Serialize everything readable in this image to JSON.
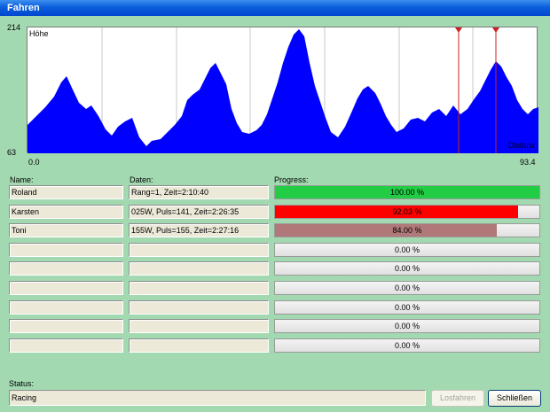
{
  "window": {
    "title": "Fahren"
  },
  "chart": {
    "y_max": "214",
    "y_min": "63",
    "x_min": "0.0",
    "x_max": "93.4",
    "y_title": "Höhe",
    "x_title": "Distanz",
    "area_color": "#0000ff",
    "marker_color": "#cc2222"
  },
  "columns": {
    "name": "Name:",
    "data": "Daten:",
    "progress": "Progress:"
  },
  "rows": [
    {
      "name": "Roland",
      "data": "Rang=1, Zeit=2:10:40",
      "progress": 1.0,
      "progress_text": "100.00 %",
      "color": "#22cc44"
    },
    {
      "name": "Karsten",
      "data": "025W, Puls=141, Zeit=2:26:35",
      "progress": 0.9203,
      "progress_text": "92.03 %",
      "color": "#ff0000"
    },
    {
      "name": "Toni",
      "data": "155W, Puls=155, Zeit=2:27:16",
      "progress": 0.84,
      "progress_text": "84.00 %",
      "color": "#b07878"
    },
    {
      "name": "",
      "data": "",
      "progress": 0,
      "progress_text": "0.00 %",
      "color": "#cccccc"
    },
    {
      "name": "",
      "data": "",
      "progress": 0,
      "progress_text": "0.00 %",
      "color": "#cccccc"
    },
    {
      "name": "",
      "data": "",
      "progress": 0,
      "progress_text": "0.00 %",
      "color": "#cccccc"
    },
    {
      "name": "",
      "data": "",
      "progress": 0,
      "progress_text": "0.00 %",
      "color": "#cccccc"
    },
    {
      "name": "",
      "data": "",
      "progress": 0,
      "progress_text": "0.00 %",
      "color": "#cccccc"
    },
    {
      "name": "",
      "data": "",
      "progress": 0,
      "progress_text": "0.00 %",
      "color": "#cccccc"
    }
  ],
  "status": {
    "label": "Status:",
    "value": "Racing"
  },
  "buttons": {
    "start": "Losfahren",
    "close": "Schließen"
  }
}
